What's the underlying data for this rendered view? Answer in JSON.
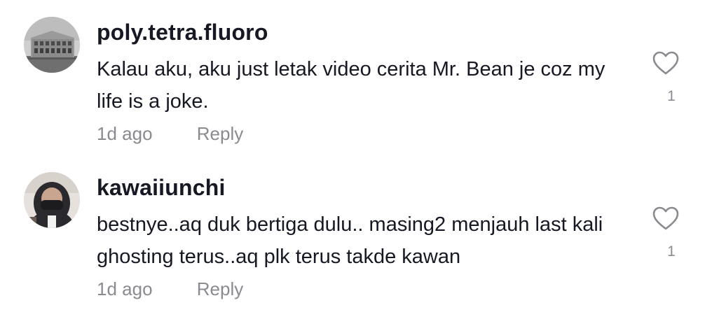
{
  "comments": [
    {
      "username": "poly.tetra.fluoro",
      "text": "Kalau aku, aku just letak video cerita Mr. Bean je coz my life is a joke.",
      "time": "1d ago",
      "reply_label": "Reply",
      "like_count": "1",
      "avatar_icon": "building-photo-avatar"
    },
    {
      "username": "kawaiiunchi",
      "text": "bestnye..aq duk bertiga dulu.. masing2 menjauh last kali ghosting terus..aq plk terus takde kawan",
      "time": "1d ago",
      "reply_label": "Reply",
      "like_count": "1",
      "avatar_icon": "masked-person-avatar"
    }
  ],
  "colors": {
    "primary_text": "#161823",
    "secondary_text": "#8a8b91",
    "heart_stroke": "#8a8b91",
    "background": "#ffffff"
  }
}
